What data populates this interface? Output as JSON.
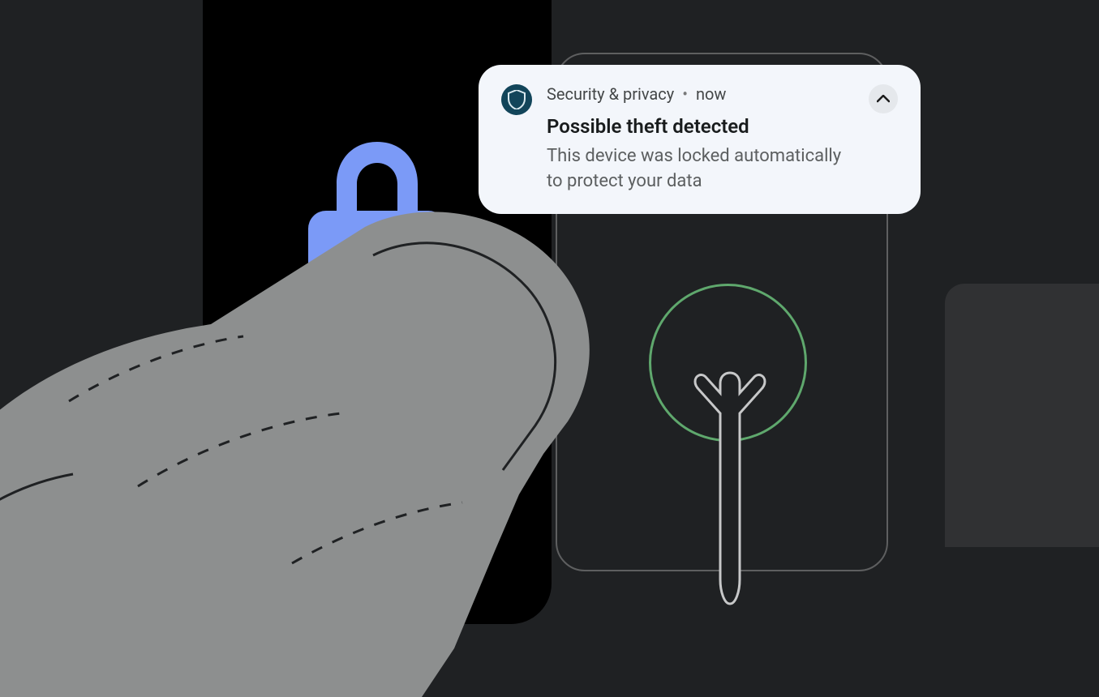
{
  "notification": {
    "app_name": "Security & privacy",
    "timestamp": "now",
    "title": "Possible theft detected",
    "body": "This device was locked automatically to protect your data"
  },
  "colors": {
    "lock_icon": "#7b9af7",
    "tree_circle": "#5fa86d",
    "hand": "#8d8f8f",
    "badge_bg": "#12455a"
  }
}
